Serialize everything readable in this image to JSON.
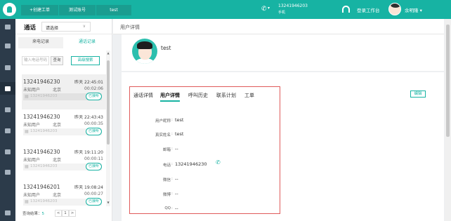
{
  "topbar": {
    "ticket_create": "+创建工单",
    "test_account": "测试账号",
    "test": "test",
    "phone_icon": "phone-icon",
    "phone_number": "13241946203",
    "phone_location": "手机",
    "login_label": "登录工作台",
    "user_name": "余明隆 ▾"
  },
  "sidebar": {
    "items": [
      "home-icon",
      "grid-icon",
      "doc-icon",
      "phone-icon",
      "user-icon",
      "team-icon",
      "chart-icon",
      "settings-icon",
      "keyboard-icon"
    ],
    "active_index": 3
  },
  "panel": {
    "title": "通话",
    "select_value": "请选择",
    "tabs": [
      "来电记录",
      "通话记录"
    ],
    "search_placeholder": "输入电话号码",
    "search_btn": "查询",
    "advanced_btn": "高级搜索",
    "records": [
      {
        "number": "13241946230",
        "time": "昨天 22:45:01",
        "user": "未知用户",
        "city": "北京",
        "duration": "00:02:06",
        "sub_number": "13241946203",
        "status": "已接听"
      },
      {
        "number": "13241946230",
        "time": "昨天 22:43:43",
        "user": "未知用户",
        "city": "北京",
        "duration": "00:00:35",
        "sub_number": "13241946203",
        "status": "已接听"
      },
      {
        "number": "13241946230",
        "time": "昨天 19:11:20",
        "user": "未知用户",
        "city": "北京",
        "duration": "00:00:11",
        "sub_number": "13241946203",
        "status": "已接听"
      },
      {
        "number": "13241946201",
        "time": "昨天 19:08:24",
        "user": "未知用户",
        "city": "北京",
        "duration": "00:00:27",
        "sub_number": "13241946203",
        "status": "已接听"
      }
    ],
    "pager_label": "查询结果：",
    "pager_count": "5",
    "pager_prev": "<",
    "pager_page": "1",
    "pager_next": ">"
  },
  "main": {
    "header": "用户详情",
    "profile_name": "test",
    "tabs": [
      "通话详情",
      "用户详情",
      "呼叫历史",
      "联系计划",
      "工单"
    ],
    "active_tab": 1,
    "edit_btn": "编辑",
    "fields": [
      {
        "label": "用户昵称",
        "value": "test"
      },
      {
        "label": "真实姓名",
        "value": "test"
      },
      {
        "label": "邮箱",
        "value": "--"
      },
      {
        "label": "电话",
        "value": "13241946230"
      },
      {
        "label": "微信",
        "value": "--"
      },
      {
        "label": "微博",
        "value": "--"
      },
      {
        "label": "QQ",
        "value": "--"
      }
    ]
  }
}
